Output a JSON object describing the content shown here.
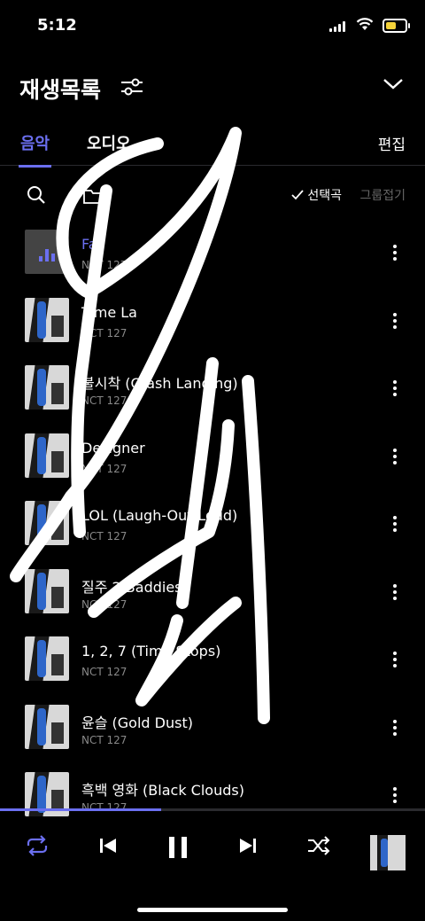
{
  "status": {
    "time": "5:12"
  },
  "header": {
    "title": "재생목록"
  },
  "tabs": {
    "music": "음악",
    "audio": "오디오",
    "edit": "편집"
  },
  "tools": {
    "selected": "선택곡",
    "group": "그룹접기"
  },
  "songs": [
    {
      "title": "Fa",
      "artist": "NCT 127",
      "active": true
    },
    {
      "title": "Time La",
      "artist": "NCT 127"
    },
    {
      "title": "불시착 (Crash Landing)",
      "artist": "NCT 127"
    },
    {
      "title": "Designer",
      "artist": "NCT 127"
    },
    {
      "title": "LOL (Laugh-Out-Loud)",
      "artist": "NCT 127"
    },
    {
      "title": "질주 2 Baddies)",
      "artist": "NCT 127"
    },
    {
      "title": "1, 2, 7 (Time Stops)",
      "artist": "NCT 127"
    },
    {
      "title": "윤슬 (Gold Dust)",
      "artist": "NCT 127"
    },
    {
      "title": "흑백 영화 (Black Clouds)",
      "artist": "NCT 127"
    }
  ],
  "player": {
    "progress": 0.38
  },
  "colors": {
    "accent": "#6b6ff0",
    "background": "#000000"
  }
}
